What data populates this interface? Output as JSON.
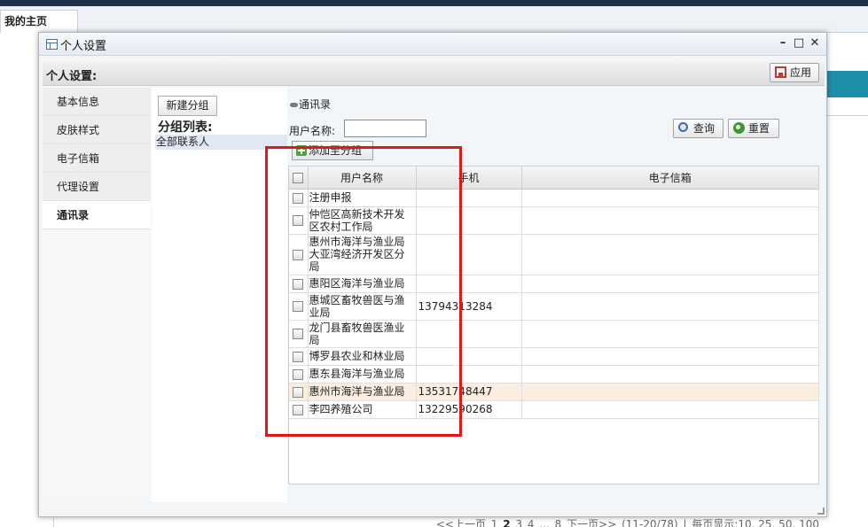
{
  "page": {
    "home_tab": "我的主页"
  },
  "dialog": {
    "title": "个人设置",
    "win_minimize": "–",
    "win_maximize": "□",
    "win_close": "✕",
    "toolbar_title": "个人设置:",
    "apply_label": "应用"
  },
  "nav": {
    "items": [
      "基本信息",
      "皮肤样式",
      "电子信箱",
      "代理设置",
      "通讯录"
    ],
    "active_index": 4
  },
  "groups": {
    "new_group_label": "新建分组",
    "list_title": "分组列表:",
    "items": [
      "全部联系人"
    ]
  },
  "content": {
    "breadcrumb": "通讯录",
    "username_label": "用户名称:",
    "username_value": "",
    "search_label": "查询",
    "reset_label": "重置",
    "add_all_label": "添加至分组"
  },
  "table": {
    "columns": [
      "用户名称",
      "手机",
      "电子信箱"
    ],
    "rows": [
      {
        "name": "注册申报",
        "phone": "",
        "email": ""
      },
      {
        "name": "仲恺区高新技术开发区农村工作局",
        "phone": "",
        "email": ""
      },
      {
        "name": "惠州市海洋与渔业局大亚湾经济开发区分局",
        "phone": "",
        "email": ""
      },
      {
        "name": "惠阳区海洋与渔业局",
        "phone": "",
        "email": ""
      },
      {
        "name": "惠城区畜牧兽医与渔业局",
        "phone": "13794313284",
        "email": ""
      },
      {
        "name": "龙门县畜牧兽医渔业局",
        "phone": "",
        "email": ""
      },
      {
        "name": "博罗县农业和林业局",
        "phone": "",
        "email": ""
      },
      {
        "name": "惠东县海洋与渔业局",
        "phone": "",
        "email": ""
      },
      {
        "name": "惠州市海洋与渔业局",
        "phone": "13531748447",
        "email": ""
      },
      {
        "name": "李四养殖公司",
        "phone": "13229590268",
        "email": ""
      }
    ],
    "highlight_row_index": 8
  },
  "pager": {
    "prev": "<<上一页",
    "pages": [
      "1",
      "2",
      "3",
      "4"
    ],
    "current": "2",
    "ellipsis": "...",
    "last": "8",
    "next": "下一页>>",
    "range": "(11-20/78)",
    "separator": "|",
    "per_page": "每页显示:10, 25, 50, 100"
  },
  "colors": {
    "annotation_box": "#e01818",
    "highlight_row": "#fbeee0"
  }
}
